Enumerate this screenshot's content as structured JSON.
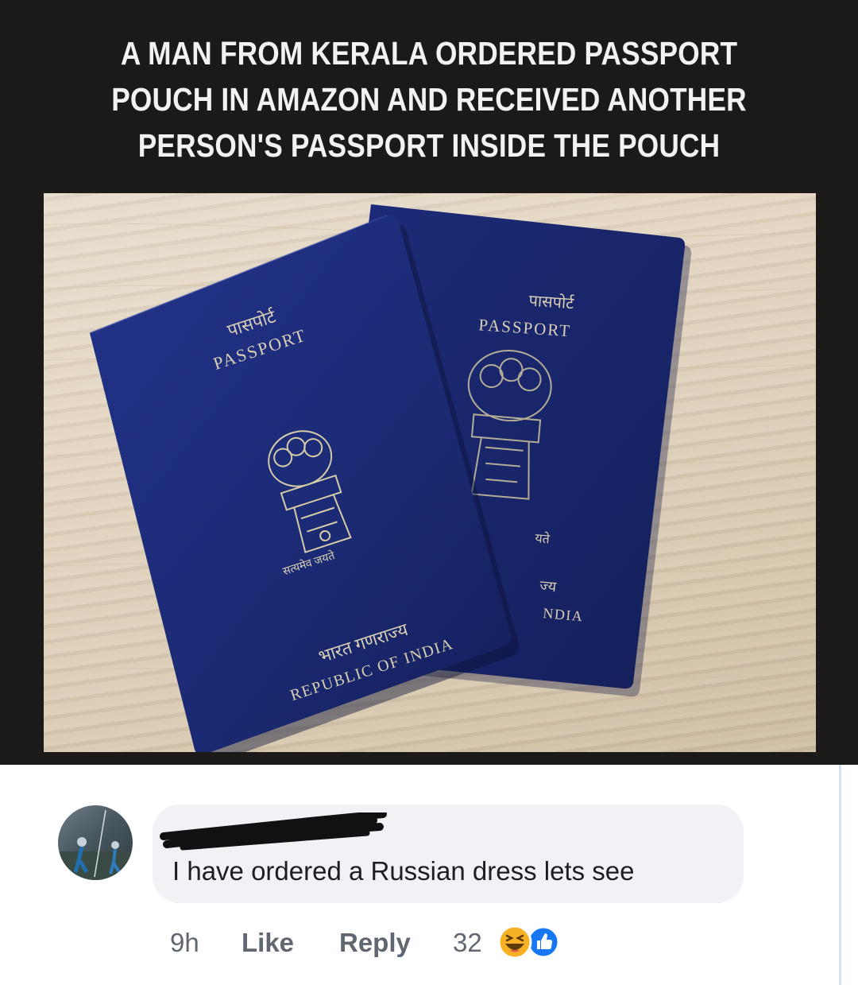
{
  "post": {
    "headline": "A MAN FROM KERALA ORDERED PASSPORT\nPOUCH IN AMAZON AND RECEIVED ANOTHER\nPERSON'S PASSPORT INSIDE THE POUCH",
    "photo": {
      "front_passport": {
        "hindi_title": "पासपोर्ट",
        "title": "PASSPORT",
        "emblem_motto": "सत्यमेव जयते",
        "hindi_country": "भारत गणराज्य",
        "country": "REPUBLIC OF INDIA"
      },
      "back_passport": {
        "hindi_title": "पासपोर्ट",
        "title": "PASSPORT",
        "partial_motto": "यते",
        "partial_hindi": "ज्य",
        "partial_country": "NDIA"
      }
    }
  },
  "comment": {
    "text": "I have ordered a Russian dress lets see",
    "time": "9h",
    "like_label": "Like",
    "reply_label": "Reply",
    "reaction_count": "32",
    "reactions": [
      "haha-icon",
      "like-icon"
    ]
  },
  "colors": {
    "post_background": "#1b1a19",
    "headline_text": "#f2f2f2",
    "passport_blue": "#1b2a73",
    "passport_gold": "#d9cfb4",
    "comment_bubble": "#f0f2f5",
    "comment_text": "#1c1e21",
    "action_text": "#606770",
    "like_blue": "#1877f2",
    "haha_yellow": "#f7b125"
  }
}
